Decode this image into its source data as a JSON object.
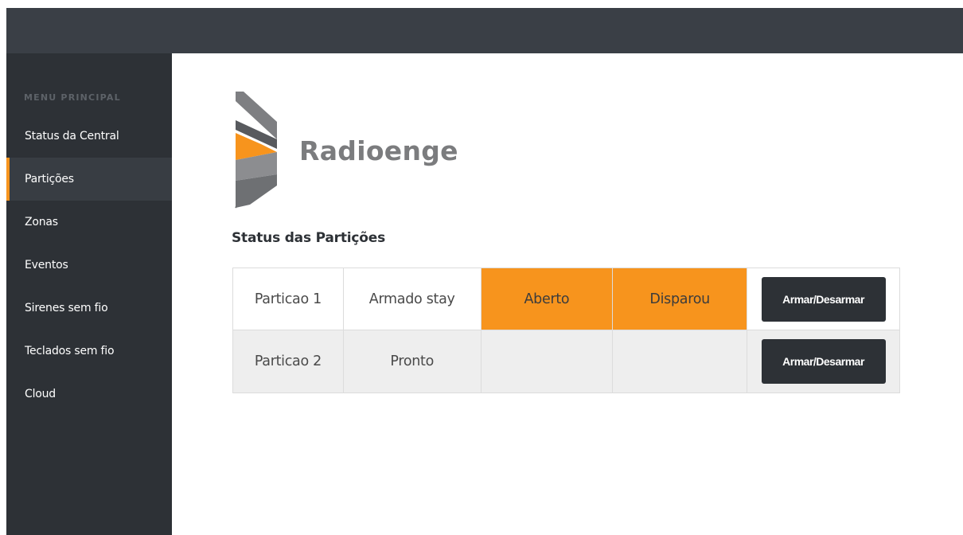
{
  "sidebar": {
    "header": "MENU PRINCIPAL",
    "items": [
      {
        "label": "Status da Central",
        "active": false
      },
      {
        "label": "Partições",
        "active": true
      },
      {
        "label": "Zonas",
        "active": false
      },
      {
        "label": "Eventos",
        "active": false
      },
      {
        "label": "Sirenes sem fio",
        "active": false
      },
      {
        "label": "Teclados sem fio",
        "active": false
      },
      {
        "label": "Cloud",
        "active": false
      }
    ]
  },
  "logo": {
    "text": "Radioenge",
    "icon": "radioenge-logo-icon"
  },
  "main": {
    "section_title": "Status das Partições",
    "table": {
      "rows": [
        {
          "name": "Particao 1",
          "state": "Armado stay",
          "open": "Aberto",
          "fired": "Disparou",
          "action": "Armar/Desarmar",
          "open_alert": true,
          "fired_alert": true
        },
        {
          "name": "Particao 2",
          "state": "Pronto",
          "open": "",
          "fired": "",
          "action": "Armar/Desarmar",
          "open_alert": false,
          "fired_alert": false
        }
      ]
    }
  },
  "colors": {
    "accent": "#f7941d",
    "sidebar_bg": "#2d3136",
    "topbar_bg": "#3a3f46",
    "button_bg": "#2d3136"
  }
}
